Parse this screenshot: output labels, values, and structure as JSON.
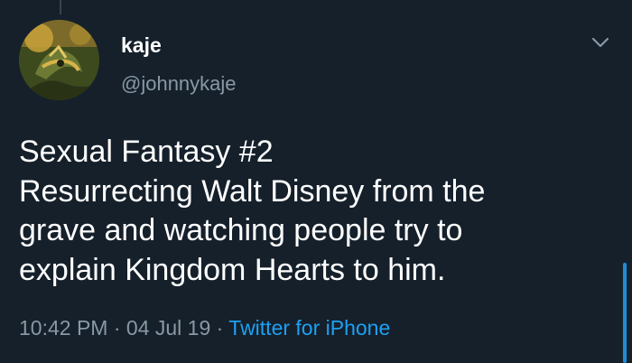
{
  "tweet": {
    "author": {
      "display_name": "kaje",
      "handle": "@johnnykaje"
    },
    "text_lines": [
      "Sexual Fantasy #2",
      "Resurrecting Walt Disney from the",
      "grave and watching people try to",
      "explain Kingdom Hearts to him."
    ],
    "meta": {
      "time": "10:42 PM",
      "separator": " · ",
      "date": "04 Jul 19",
      "source": "Twitter for iPhone"
    },
    "menu_icon": "chevron-down-icon"
  },
  "colors": {
    "background": "#15202b",
    "primary_text": "#ffffff",
    "secondary_text": "#8899a6",
    "accent": "#1da1f2"
  }
}
